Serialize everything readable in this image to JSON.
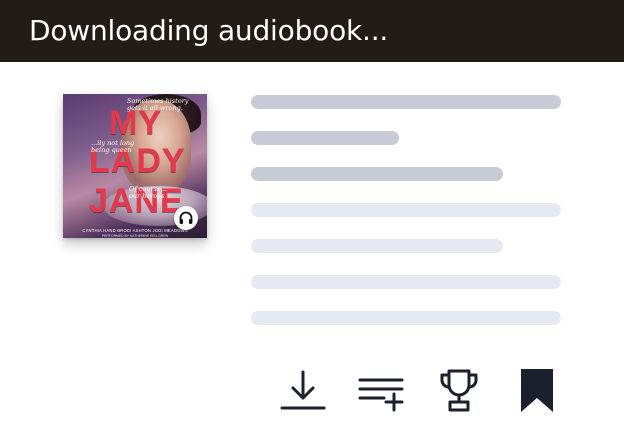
{
  "header": {
    "title": "Downloading audiobook..."
  },
  "book": {
    "cover": {
      "title_line1": "MY",
      "title_line2": "LADY",
      "title_line3": "JANE",
      "tagline1_a": "Sometimes history",
      "tagline1_b": "gets it all wrong.",
      "tagline2_a": "...ily not long",
      "tagline2_b": "being queen",
      "tagline3_a": "Of course...",
      "tagline3_b": "our heroes",
      "authors": "CYNTHIA HAND   BRODI ASHTON   JODI MEADOWS",
      "narrator": "PERFORMED BY KATHERINE KELLGREN"
    },
    "badge_icon": "headphones-icon"
  },
  "actions": {
    "download_icon": "download-icon",
    "add_to_queue_icon": "add-to-queue-icon",
    "awards_icon": "trophy-icon",
    "bookmark_icon": "bookmark-icon"
  },
  "colors": {
    "header_bg": "#221c17",
    "skeleton_dark": "#c9ccd6",
    "skeleton_light": "#e6e9f3",
    "icon": "#1b1f2e",
    "cover_title": "#e23a4b"
  }
}
